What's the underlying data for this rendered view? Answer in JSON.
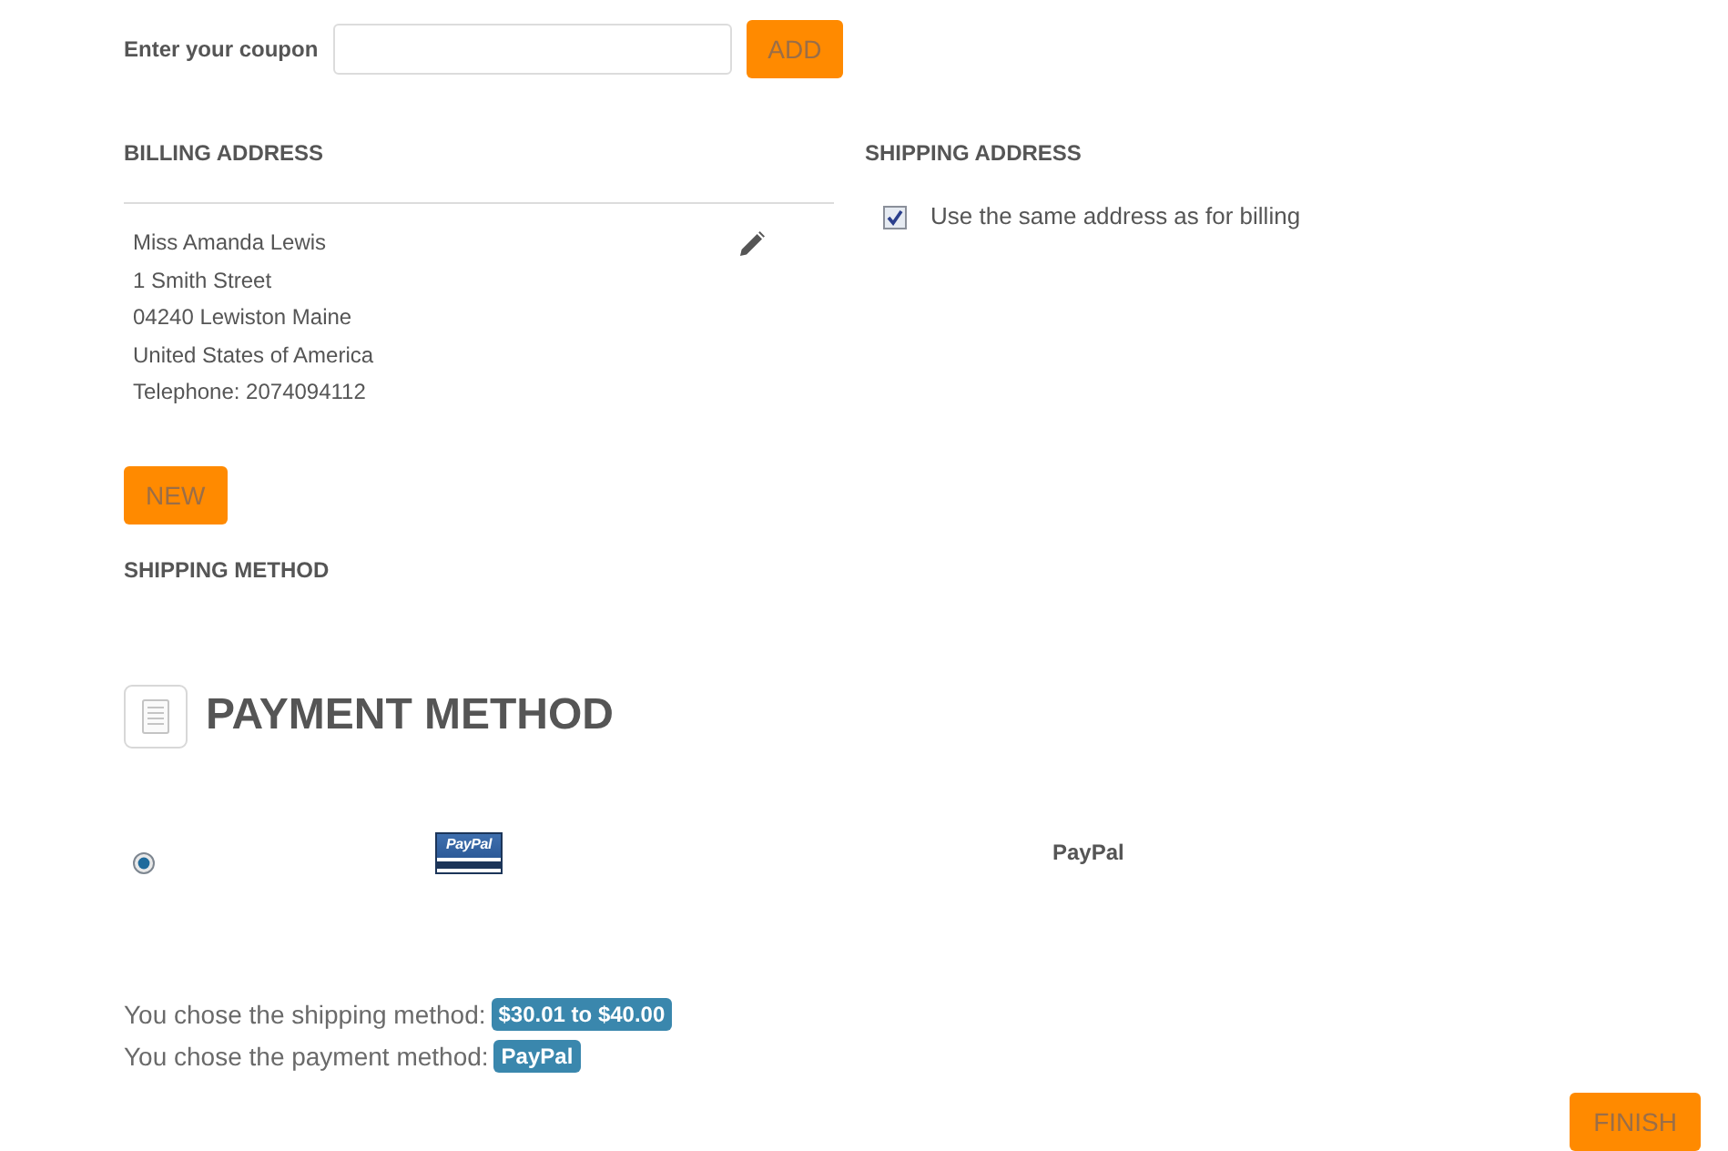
{
  "coupon": {
    "label": "Enter your coupon",
    "button": "ADD"
  },
  "billing_address": {
    "heading": "BILLING ADDRESS",
    "lines": [
      "Miss Amanda Lewis",
      "1 Smith Street",
      "04240 Lewiston Maine",
      "United States of America",
      "Telephone: 2074094112"
    ],
    "new_button": "NEW"
  },
  "shipping_address": {
    "heading": "SHIPPING ADDRESS",
    "same_as_billing": {
      "label": "Use the same address as for billing",
      "checked": true
    }
  },
  "shipping_method": {
    "heading": "SHIPPING METHOD"
  },
  "payment_method": {
    "heading": "PAYMENT METHOD",
    "options": [
      {
        "logo_text": "PayPal",
        "name": "PayPal",
        "selected": true
      }
    ]
  },
  "summary": [
    {
      "text": "You chose the shipping method:",
      "badge": "$30.01 to $40.00"
    },
    {
      "text": "You chose the payment method:",
      "badge": "PayPal"
    }
  ],
  "finish_button": "FINISH"
}
